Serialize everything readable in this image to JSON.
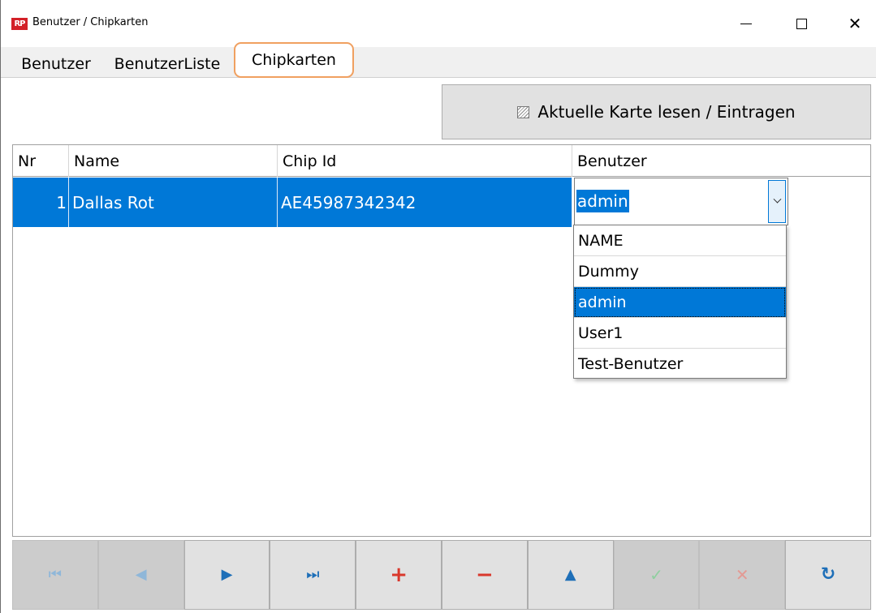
{
  "window": {
    "title": "Benutzer / Chipkarten",
    "logo_text": "RP"
  },
  "tabs": [
    {
      "label": "Benutzer",
      "active": false
    },
    {
      "label": "BenutzerListe",
      "active": false
    },
    {
      "label": "Chipkarten",
      "active": true
    }
  ],
  "actions": {
    "read_card_label": "Aktuelle Karte lesen / Eintragen"
  },
  "grid": {
    "columns": [
      "Nr",
      "Name",
      "Chip Id",
      "Benutzer"
    ],
    "rows": [
      {
        "nr": "1",
        "name": "Dallas Rot",
        "chip_id": "AE45987342342",
        "benutzer": "admin"
      }
    ]
  },
  "benutzer_dropdown": {
    "selected": "admin",
    "options": [
      "NAME",
      "Dummy",
      "admin",
      "User1",
      "Test-Benutzer"
    ]
  },
  "navigator": [
    {
      "name": "first",
      "glyph": "⏮",
      "enabled": false,
      "color": "#8fb7d9"
    },
    {
      "name": "prior",
      "glyph": "◀",
      "enabled": false,
      "color": "#8fb7d9"
    },
    {
      "name": "next",
      "glyph": "▶",
      "enabled": true,
      "color": "#1e6fb8"
    },
    {
      "name": "last",
      "glyph": "⏭",
      "enabled": true,
      "color": "#1e6fb8"
    },
    {
      "name": "insert",
      "glyph": "+",
      "enabled": true,
      "color": "#d9382c"
    },
    {
      "name": "delete",
      "glyph": "−",
      "enabled": true,
      "color": "#d9382c"
    },
    {
      "name": "edit",
      "glyph": "▲",
      "enabled": true,
      "color": "#1e6fb8"
    },
    {
      "name": "post",
      "glyph": "✓",
      "enabled": false,
      "color": "#8fcf9f"
    },
    {
      "name": "cancel",
      "glyph": "✕",
      "enabled": false,
      "color": "#e39a94"
    },
    {
      "name": "refresh",
      "glyph": "↻",
      "enabled": true,
      "color": "#1e6fb8"
    }
  ],
  "colors": {
    "selection": "#0078d7",
    "tab_highlight": "#f0a060"
  }
}
